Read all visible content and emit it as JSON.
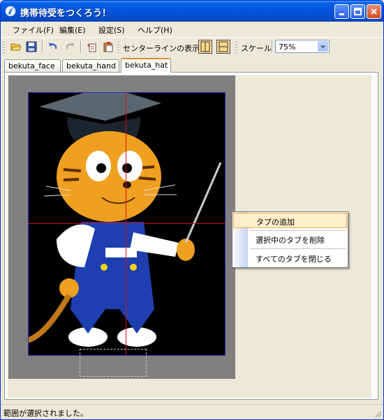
{
  "window": {
    "title": "携帯待受をつくろう！",
    "controls": {
      "minimize": "minimize-icon",
      "maximize": "maximize-icon",
      "close": "close-icon"
    }
  },
  "menu": {
    "items": [
      {
        "label": "ファイル(F)"
      },
      {
        "label": "編集(E)"
      },
      {
        "label": "設定(S)"
      },
      {
        "label": "ヘルプ(H)"
      }
    ]
  },
  "toolbar": {
    "centerline_label": "センターラインの表示",
    "scale_label": "スケール",
    "scale_value": "75%",
    "icons": [
      "open-folder-icon",
      "save-icon",
      "undo-icon",
      "redo-icon",
      "copy-icon",
      "paste-icon",
      "vertical-centerline-icon",
      "horizontal-centerline-icon"
    ]
  },
  "tabs": [
    {
      "label": "bekuta_face"
    },
    {
      "label": "bekuta_hand"
    },
    {
      "label": "bekuta_hat"
    }
  ],
  "active_tab": "bekuta_hat",
  "context_menu": {
    "items": [
      {
        "label": "タブの追加"
      },
      {
        "label": "選択中のタブを削除"
      },
      {
        "label": "すべてのタブを閉じる"
      }
    ]
  },
  "status": {
    "text": "範囲が選択されました。"
  },
  "colors": {
    "titlebar": "#0453d9",
    "guide_line": "#d01010",
    "toggle_active": "#ffd88a",
    "menu_hover": "#ffeeca"
  }
}
